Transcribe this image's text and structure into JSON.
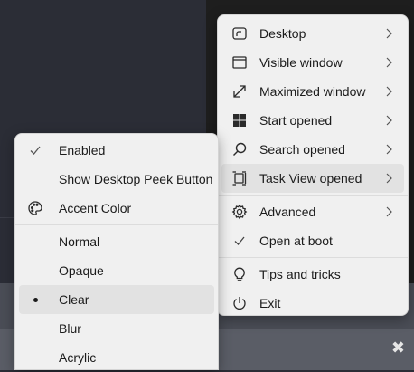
{
  "main_menu": {
    "items": [
      {
        "label": "Desktop",
        "icon": "desktop-icon"
      },
      {
        "label": "Visible window",
        "icon": "window-icon"
      },
      {
        "label": "Maximized window",
        "icon": "maximize-icon"
      },
      {
        "label": "Start opened",
        "icon": "windows-logo-icon"
      },
      {
        "label": "Search opened",
        "icon": "search-icon"
      },
      {
        "label": "Task View opened",
        "icon": "task-view-icon"
      },
      {
        "label": "Advanced",
        "icon": "gear-icon"
      },
      {
        "label": "Open at boot",
        "icon": "checkmark-icon"
      },
      {
        "label": "Tips and tricks",
        "icon": "lightbulb-icon"
      },
      {
        "label": "Exit",
        "icon": "power-icon"
      }
    ],
    "highlighted": "Task View opened"
  },
  "submenu": {
    "items": [
      {
        "label": "Enabled",
        "icon": "checkmark-icon"
      },
      {
        "label": "Show Desktop Peek Button"
      },
      {
        "label": "Accent Color",
        "icon": "palette-icon"
      },
      {
        "label": "Normal"
      },
      {
        "label": "Opaque"
      },
      {
        "label": "Clear",
        "icon": "bullet-icon"
      },
      {
        "label": "Blur"
      },
      {
        "label": "Acrylic"
      }
    ],
    "selected": "Clear"
  },
  "close_glyph": "✖"
}
